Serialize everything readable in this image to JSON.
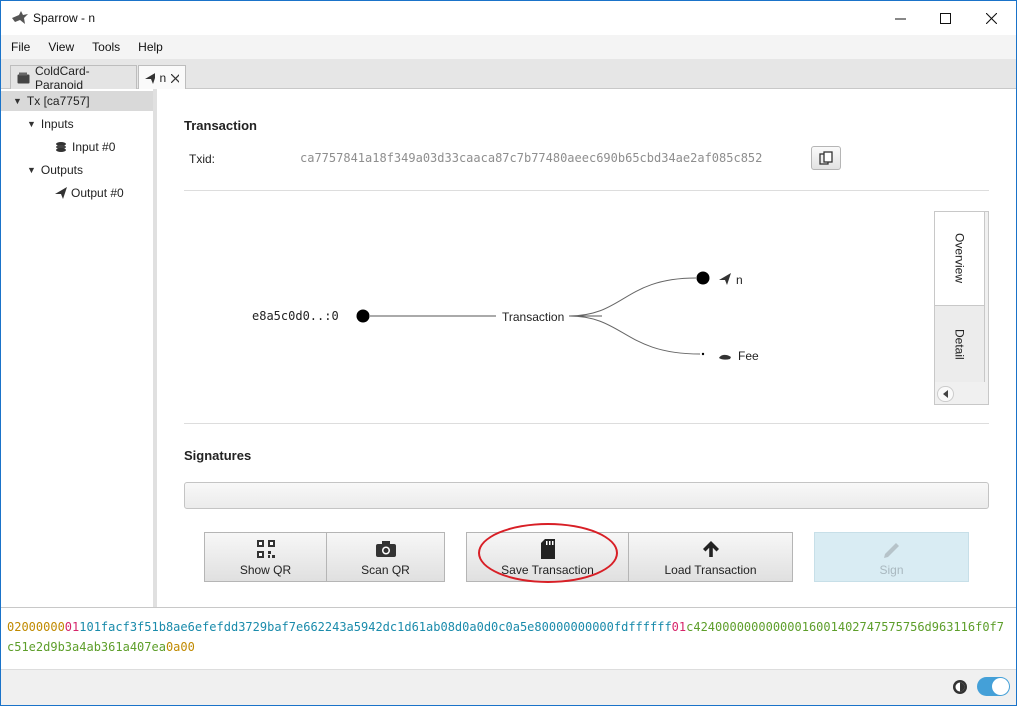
{
  "window": {
    "title": "Sparrow - n",
    "controls": [
      "minimize",
      "maximize",
      "close"
    ]
  },
  "menu": [
    "File",
    "View",
    "Tools",
    "Help"
  ],
  "tabs": [
    {
      "label": "ColdCard-Paranoid",
      "icon": "wallet-icon"
    },
    {
      "label": "n",
      "icon": "send-icon",
      "closable": true
    }
  ],
  "tree": {
    "root": "Tx [ca7757]",
    "inputs_label": "Inputs",
    "input_item": "Input #0",
    "outputs_label": "Outputs",
    "output_item": "Output #0"
  },
  "transaction": {
    "heading": "Transaction",
    "txid_label": "Txid:",
    "txid": "ca7757841a18f349a03d33caaca87c7b77480aeec690b65cbd34ae2af085c852"
  },
  "diagram": {
    "input_label": "e8a5c0d0..:0",
    "center_label": "Transaction",
    "output_label": "n",
    "fee_label": "Fee"
  },
  "side_tabs": [
    "Overview",
    "Detail"
  ],
  "signatures": {
    "heading": "Signatures"
  },
  "buttons": {
    "show_qr": "Show QR",
    "scan_qr": "Scan QR",
    "save_transaction": "Save Transaction",
    "load_transaction": "Load Transaction",
    "sign": "Sign"
  },
  "hex": {
    "segments": [
      {
        "text": "02000000",
        "color": "#c08a00"
      },
      {
        "text": "01",
        "color": "#d6256a"
      },
      {
        "text": "101facf3f51b8ae6efefdd3729baf7e662243a5942dc1d61ab08d0a0d0c0a5e80000000000fdffffff",
        "color": "#1a8bab"
      },
      {
        "text": "01",
        "color": "#d6256a"
      },
      {
        "text": "c424000000000000160014027475757 56d963116f0f7c51e2d9b3a4ab361a407ea",
        "color": "#5d9e2a"
      },
      {
        "text": "0a00",
        "color": "#c08a00"
      }
    ]
  },
  "colors": {
    "accent": "#1a73c9",
    "toggle": "#44a0d8",
    "annotation": "#d81f26"
  }
}
